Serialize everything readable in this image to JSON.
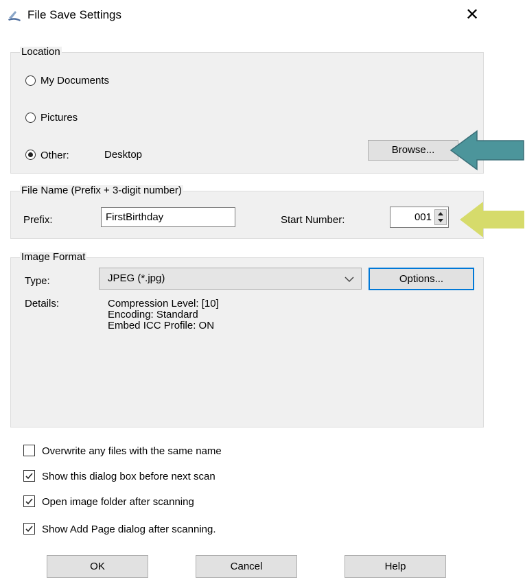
{
  "window": {
    "title": "File Save Settings",
    "close_glyph": "✕"
  },
  "location": {
    "group_label": "Location",
    "options": [
      {
        "label": "My Documents",
        "checked": false
      },
      {
        "label": "Pictures",
        "checked": false
      },
      {
        "label": "Other:",
        "checked": true
      }
    ],
    "other_value": "Desktop",
    "browse_label": "Browse..."
  },
  "file_name": {
    "group_label": "File Name (Prefix + 3-digit number)",
    "prefix_label": "Prefix:",
    "prefix_value": "FirstBirthday",
    "start_number_label": "Start Number:",
    "start_number_value": "001"
  },
  "image_format": {
    "group_label": "Image Format",
    "type_label": "Type:",
    "type_value": "JPEG (*.jpg)",
    "options_label": "Options...",
    "details_label": "Details:",
    "details": [
      "Compression Level: [10]",
      "Encoding: Standard",
      "Embed ICC Profile: ON"
    ]
  },
  "checkboxes": [
    {
      "label": "Overwrite any files with the same name",
      "checked": false
    },
    {
      "label": "Show this dialog box before next scan",
      "checked": true
    },
    {
      "label": "Open image folder after scanning",
      "checked": true
    },
    {
      "label": "Show Add Page dialog after scanning.",
      "checked": true
    }
  ],
  "buttons": {
    "ok": "OK",
    "cancel": "Cancel",
    "help": "Help"
  },
  "annotations": {
    "arrow1_color": "#4c959b",
    "arrow2_color": "#d6db6b"
  }
}
